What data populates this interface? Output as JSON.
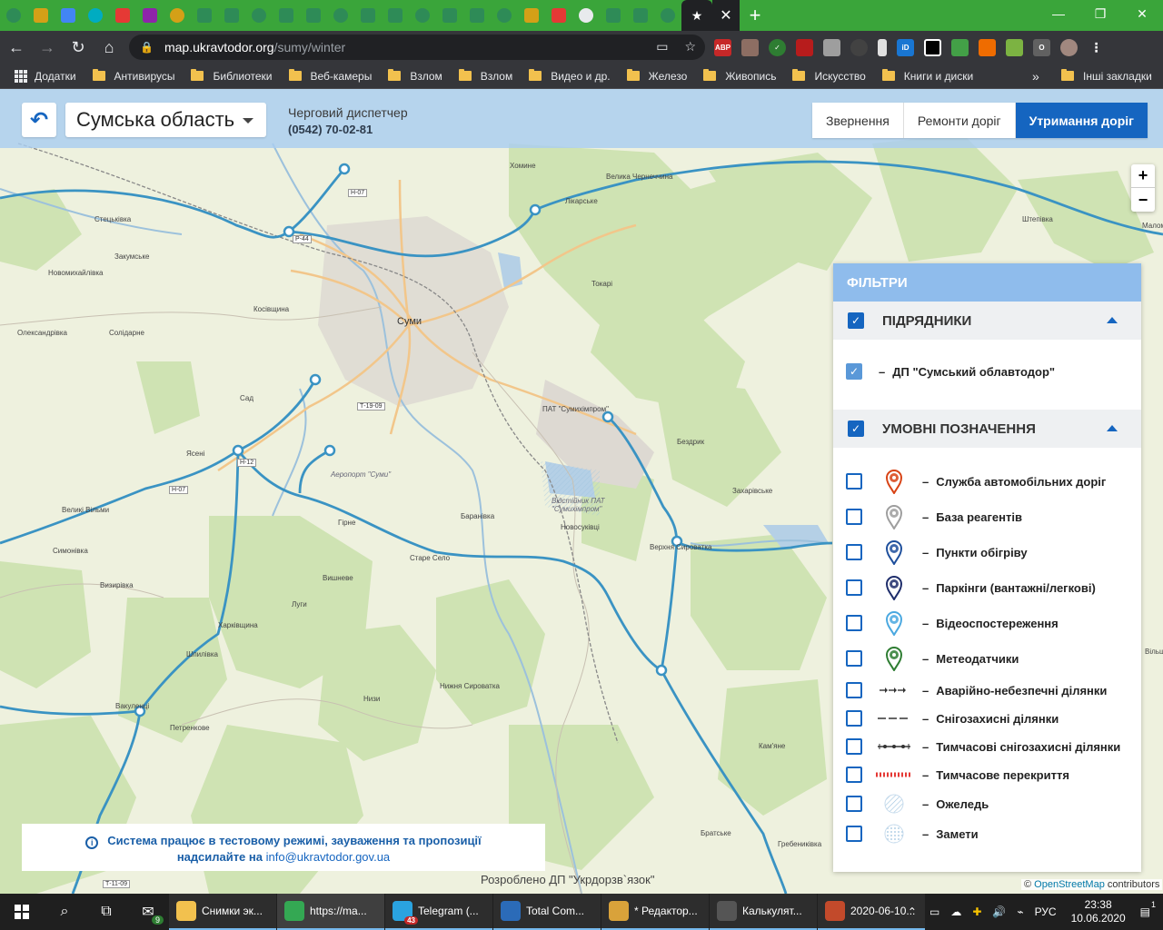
{
  "browser": {
    "url_host": "map.ukravtodor.org",
    "url_path": "/sumy/winter",
    "bookmarks": [
      "Додатки",
      "Антивирусы",
      "Библиотеки",
      "Веб-камеры",
      "Взлом",
      "Взлом",
      "Видео и др.",
      "Железо",
      "Живопись",
      "Искусство",
      "Книги и диски"
    ],
    "bookmarks_more": "»",
    "other_bookmarks": "Інші закладки",
    "tab_favicons": [
      "green",
      "yellow",
      "blue",
      "cyan",
      "red",
      "purple",
      "yellow",
      "green",
      "green",
      "green",
      "green",
      "green",
      "green",
      "green",
      "green",
      "green",
      "green",
      "green",
      "green",
      "yellow",
      "red",
      "white",
      "green",
      "green",
      "green",
      "star"
    ]
  },
  "header": {
    "region": "Сумська область",
    "dispatcher_label": "Черговий диспетчер",
    "dispatcher_phone": "(0542) 70-02-81",
    "tabs": [
      {
        "label": "Звернення",
        "active": false
      },
      {
        "label": "Ремонти доріг",
        "active": false
      },
      {
        "label": "Утримання доріг",
        "active": true
      }
    ]
  },
  "zoom": {
    "plus": "+",
    "minus": "−"
  },
  "filters": {
    "title": "ФІЛЬТРИ",
    "contractors": {
      "title": "ПІДРЯДНИКИ",
      "checked": true,
      "items": [
        {
          "label": "ДП \"Сумський облавтодор\"",
          "checked": true
        }
      ]
    },
    "legend": {
      "title": "УМОВНІ ПОЗНАЧЕННЯ",
      "checked": true,
      "items": [
        {
          "label": "Служба автомобільних доріг",
          "icon": "road-service-pin-icon",
          "checked": false
        },
        {
          "label": "База реагентів",
          "icon": "reagent-base-pin-icon",
          "checked": false
        },
        {
          "label": "Пункти обігріву",
          "icon": "heating-point-pin-icon",
          "checked": false
        },
        {
          "label": "Паркінги (вантажні/легкові)",
          "icon": "parking-pin-icon",
          "checked": false
        },
        {
          "label": "Відеоспостереження",
          "icon": "camera-pin-icon",
          "checked": false
        },
        {
          "label": "Метеодатчики",
          "icon": "weather-sensor-pin-icon",
          "checked": false
        },
        {
          "label": "Аварійно-небезпечні ділянки",
          "icon": "dangerous-section-line-icon",
          "checked": false
        },
        {
          "label": "Снігозахисні ділянки",
          "icon": "snow-protection-line-icon",
          "checked": false
        },
        {
          "label": "Тимчасові снігозахисні ділянки",
          "icon": "temp-snow-protection-line-icon",
          "checked": false
        },
        {
          "label": "Тимчасове перекриття",
          "icon": "temp-closure-line-icon",
          "checked": false
        },
        {
          "label": "Ожеледь",
          "icon": "ice-hatch-icon",
          "checked": false
        },
        {
          "label": "Замети",
          "icon": "snowdrift-dots-icon",
          "checked": false
        }
      ]
    }
  },
  "notice": {
    "line1": "Система працює в тестовому режимі, зауваження та пропозиції",
    "line2_prefix": "надсилайте на ",
    "email": "info@ukravtodor.gov.ua"
  },
  "footer": {
    "developed_by": "Розроблено ДП \"Укрдорзв`язок\"",
    "attrib_osm": "OpenStreetMap",
    "attrib_rest": " contributors",
    "attrib_copy": "©"
  },
  "map_labels": {
    "city_sumy": "Суми",
    "places": [
      "Стецьківка",
      "Хомине",
      "Велика Чернеччина",
      "Лікарське",
      "Закумське",
      "Новомихайлівка",
      "Токарі",
      "Косівщина",
      "Олександрівка",
      "Солідарне",
      "Сад",
      "Ясені",
      "Великі Вільми",
      "Аеропорт \"Суми\"",
      "Гірне",
      "Бездрик",
      "Захарівське",
      "Баранівка",
      "Новосуківці",
      "Верхня Сироватка",
      "Старе Село",
      "Симонівка",
      "Визирівка",
      "Вишневе",
      "Луги",
      "Харківщина",
      "Шпилівка",
      "Вакуленці",
      "Петренкове",
      "Низи",
      "Нижня Сироватка",
      "Кам'яне",
      "Братське",
      "Гребениківка",
      "Маломихайлівка",
      "Відстійник ПАТ \"Сумихімпром\"",
      "ПАТ \"Сумихімпром\"",
      "Штепівка",
      "Вільшанка"
    ],
    "roads": [
      "Н-07",
      "Р-44",
      "Н-12",
      "Т-19-09",
      "Н-07",
      "Т-11-09"
    ]
  },
  "taskbar": {
    "apps": [
      {
        "label": "Снимки эк...",
        "color": "#f2c14e"
      },
      {
        "label": "https://ma...",
        "color": "#34a853",
        "active": true
      },
      {
        "label": "Telegram (...",
        "color": "#2aa3e0"
      },
      {
        "label": "Total Com...",
        "color": "#2b6bb8"
      },
      {
        "label": "* Редактор...",
        "color": "#d9a23a"
      },
      {
        "label": "Калькулят...",
        "color": "#555555"
      },
      {
        "label": "2020-06-10...",
        "color": "#c24a2b"
      }
    ],
    "mail_badge": "9",
    "telegram_badge": "43",
    "lang": "РУС",
    "time": "23:38",
    "date": "10.06.2020",
    "notification_count": "1"
  },
  "colors": {
    "accent": "#1565c0",
    "route": "#3a93c3",
    "filters_header": "#8fbcec"
  }
}
